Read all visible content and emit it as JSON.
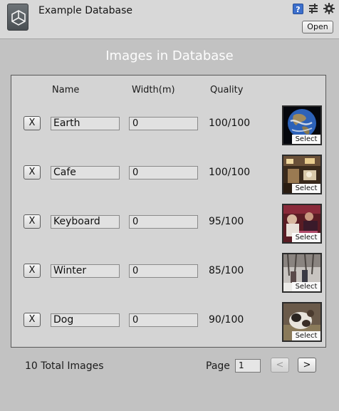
{
  "header": {
    "title": "Example Database",
    "open_label": "Open",
    "help_glyph": "?"
  },
  "section_title": "Images in Database",
  "columns": {
    "name": "Name",
    "width": "Width(m)",
    "quality": "Quality"
  },
  "rows": [
    {
      "remove_label": "X",
      "name": "Earth",
      "width": "0",
      "quality": "100/100",
      "select_label": "Select",
      "thumb": "earth"
    },
    {
      "remove_label": "X",
      "name": "Cafe",
      "width": "0",
      "quality": "100/100",
      "select_label": "Select",
      "thumb": "cafe"
    },
    {
      "remove_label": "X",
      "name": "Keyboard",
      "width": "0",
      "quality": "95/100",
      "select_label": "Select",
      "thumb": "keyboard"
    },
    {
      "remove_label": "X",
      "name": "Winter",
      "width": "0",
      "quality": "85/100",
      "select_label": "Select",
      "thumb": "winter"
    },
    {
      "remove_label": "X",
      "name": "Dog",
      "width": "0",
      "quality": "90/100",
      "select_label": "Select",
      "thumb": "dog"
    }
  ],
  "footer": {
    "total_text": "10 Total Images",
    "page_label": "Page",
    "page_value": "1",
    "prev_label": "<",
    "next_label": ">"
  }
}
